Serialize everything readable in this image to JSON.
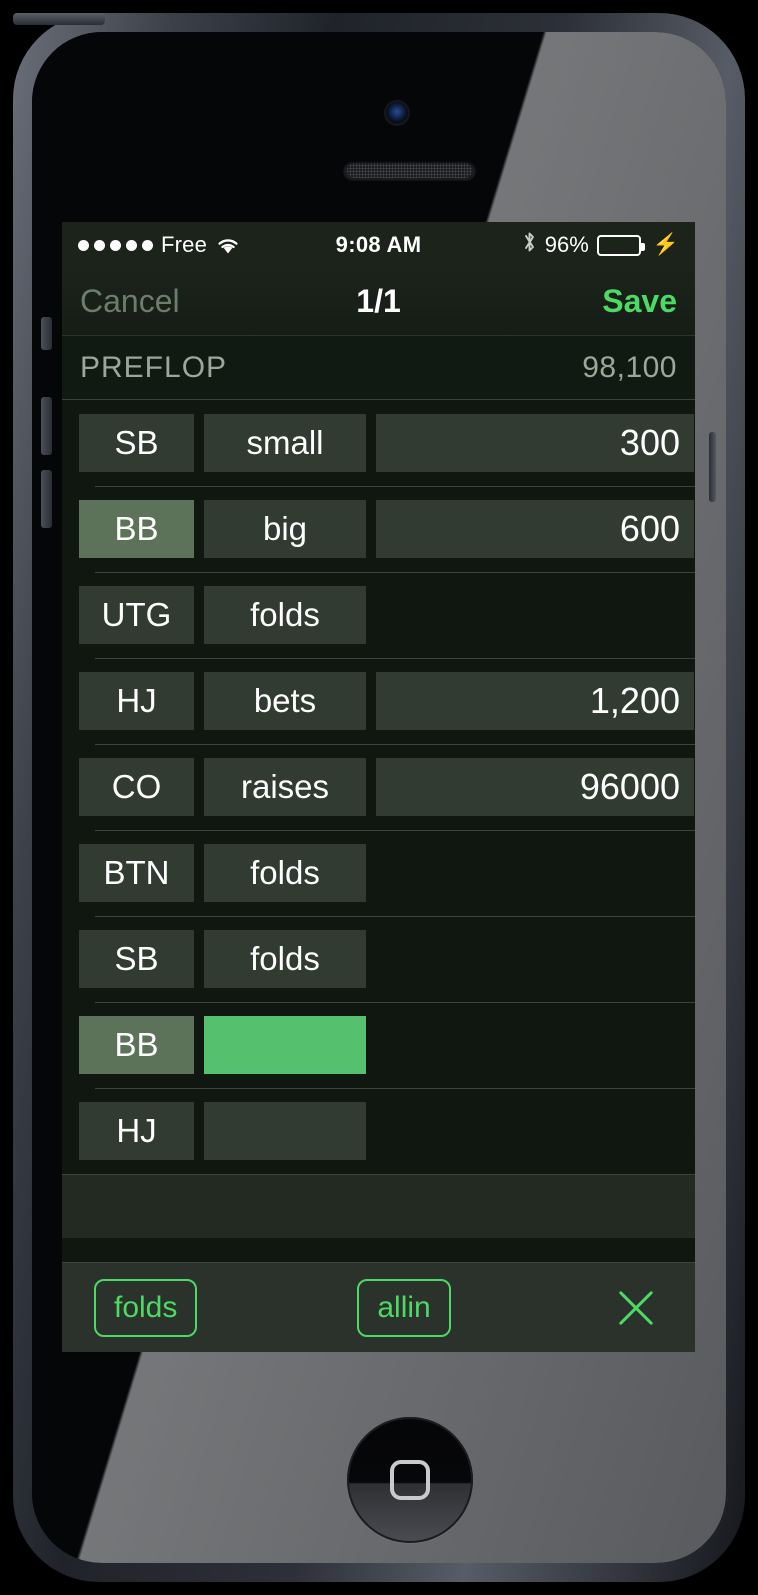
{
  "status_bar": {
    "signal_dots": 5,
    "carrier": "Free",
    "wifi_icon": "wifi-icon",
    "time": "9:08 AM",
    "bluetooth_icon": "bluetooth-icon",
    "battery_percent": "96%",
    "battery_level": 96,
    "charging_icon": "lightning-bolt-icon"
  },
  "nav_bar": {
    "cancel_label": "Cancel",
    "page_indicator": "1/1",
    "save_label": "Save"
  },
  "street": {
    "name": "PREFLOP",
    "pot": "98,100"
  },
  "actions": [
    {
      "position": "SB",
      "action": "small",
      "amount": "300",
      "position_highlight": false,
      "action_active": false
    },
    {
      "position": "BB",
      "action": "big",
      "amount": "600",
      "position_highlight": true,
      "action_active": false
    },
    {
      "position": "UTG",
      "action": "folds",
      "amount": "",
      "position_highlight": false,
      "action_active": false
    },
    {
      "position": "HJ",
      "action": "bets",
      "amount": "1,200",
      "position_highlight": false,
      "action_active": false
    },
    {
      "position": "CO",
      "action": "raises",
      "amount": "96000",
      "position_highlight": false,
      "action_active": false
    },
    {
      "position": "BTN",
      "action": "folds",
      "amount": "",
      "position_highlight": false,
      "action_active": false
    },
    {
      "position": "SB",
      "action": "folds",
      "amount": "",
      "position_highlight": false,
      "action_active": false
    },
    {
      "position": "BB",
      "action": "",
      "amount": "",
      "position_highlight": true,
      "action_active": true
    },
    {
      "position": "HJ",
      "action": "",
      "amount": "",
      "position_highlight": false,
      "action_active": false
    }
  ],
  "toolbar": {
    "folds_label": "folds",
    "allin_label": "allin",
    "close_icon": "close-x-icon"
  },
  "colors": {
    "accent_green": "#4cd964",
    "active_cell_green": "#55c16e",
    "highlight_sage": "#5c7259",
    "cell_bg": "#313b31",
    "screen_bg": "#101711"
  }
}
